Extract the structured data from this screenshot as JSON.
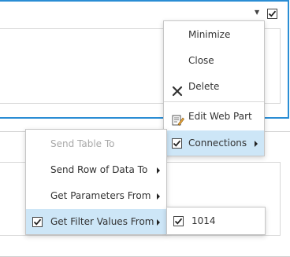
{
  "top_webpart": {
    "menu_caret_icon": "chevron-down-icon",
    "selected": true
  },
  "web_part_menu": {
    "items": [
      {
        "label": "Minimize"
      },
      {
        "label": "Close"
      },
      {
        "label": "Delete",
        "icon": "close-icon"
      },
      {
        "label": "Edit Web Part",
        "icon": "edit-icon"
      },
      {
        "label": "Connections",
        "icon": "checkbox-checked",
        "has_submenu": true,
        "selected": true
      }
    ]
  },
  "connections_menu": {
    "items": [
      {
        "label": "Send Table To",
        "disabled": true
      },
      {
        "label": "Send Row of Data To",
        "has_submenu": true
      },
      {
        "label": "Get Parameters From",
        "has_submenu": true
      },
      {
        "label": "Get Filter Values From",
        "checked": true,
        "has_submenu": true,
        "selected": true
      }
    ]
  },
  "filter_values_menu": {
    "items": [
      {
        "label": "1014",
        "checked": true
      }
    ]
  },
  "colors": {
    "accent_border": "#2a8dd4",
    "selected_background": "#cde6f7",
    "disabled_text": "#a8a8a8"
  }
}
